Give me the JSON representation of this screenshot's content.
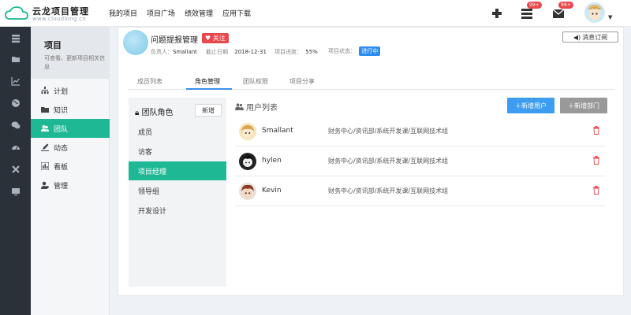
{
  "brand": {
    "name": "云龙项目管理",
    "url": "www.cloudlong.cn",
    "accent": "#1fb895",
    "blue": "#3d9df1",
    "red": "#e8474c"
  },
  "topnav": [
    "我的项目",
    "项目广场",
    "绩效管理",
    "应用下载"
  ],
  "top_badges": {
    "tasks": "99+",
    "mail": "99+"
  },
  "rail_icons": [
    "layers-icon",
    "folder-icon",
    "chart-icon",
    "globe-icon",
    "chat-icon",
    "dashboard-icon",
    "tools-icon",
    "monitor-icon"
  ],
  "sidebar": {
    "title": "项目",
    "description": "可查看、更新项目相关信息",
    "items": [
      {
        "label": "计划",
        "icon": "sitemap-icon"
      },
      {
        "label": "知识",
        "icon": "folder-icon"
      },
      {
        "label": "团队",
        "icon": "users-icon"
      },
      {
        "label": "动态",
        "icon": "pen-icon"
      },
      {
        "label": "看板",
        "icon": "board-icon"
      },
      {
        "label": "管理",
        "icon": "user-cog-icon"
      }
    ]
  },
  "project": {
    "title": "问题提报管理",
    "follow_label": "关注",
    "owner_label": "负责人：",
    "owner": "Smallant",
    "deadline_label": "截止日期",
    "deadline": "2018-12-31",
    "progress_label": "项目进度：",
    "progress": "55%",
    "status_label": "项目状态：",
    "status": "进行中",
    "subscribe_label": "消息订阅"
  },
  "tabs": [
    "成员列表",
    "角色管理",
    "团队权限",
    "项目分享"
  ],
  "roles": {
    "title": "团队角色",
    "add_label": "新增",
    "items": [
      "成员",
      "访客",
      "项目经理",
      "领导组",
      "开发设计"
    ]
  },
  "user_list": {
    "title": "用户列表",
    "add_user_label": "新增用户",
    "add_dept_label": "新增部门",
    "users": [
      {
        "name": "Smallant",
        "dept": "财务中心/资讯部/系统开发课/互联网技术组"
      },
      {
        "name": "hylen",
        "dept": "财务中心/资讯部/系统开发课/互联网技术组"
      },
      {
        "name": "Kevin",
        "dept": "财务中心/资讯部/系统开发课/互联网技术组"
      }
    ]
  }
}
